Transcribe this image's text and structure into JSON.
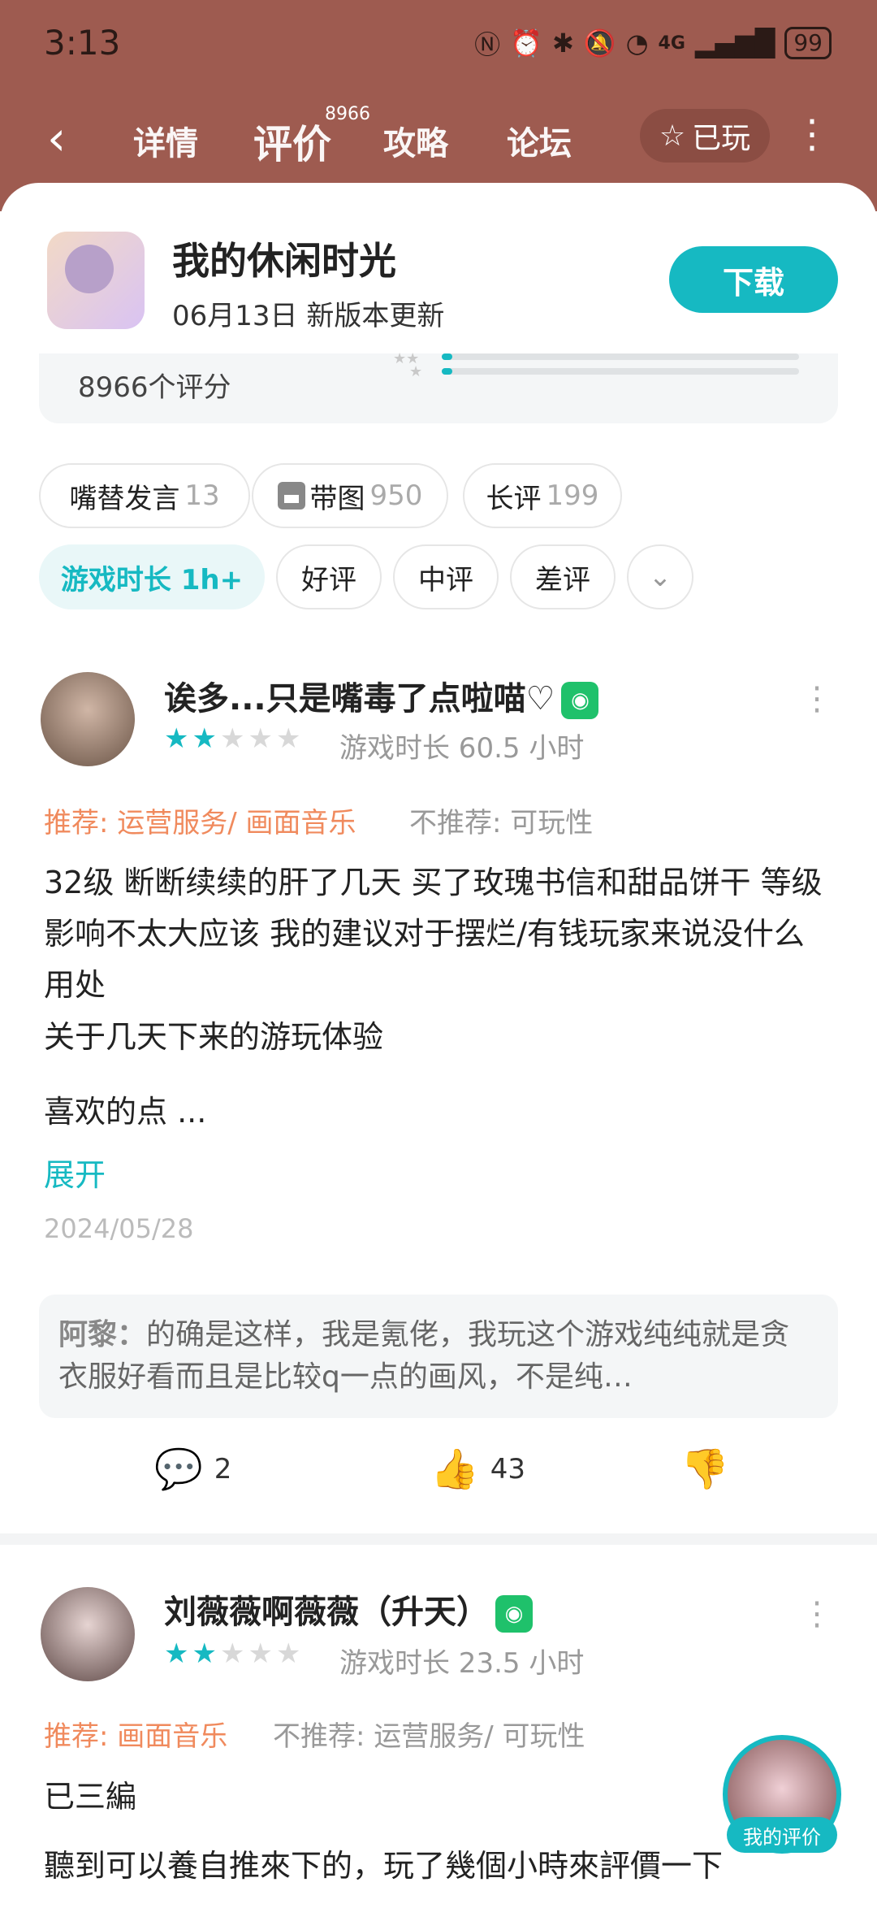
{
  "status_bar": {
    "time": "3:13",
    "battery": "99",
    "network": "4G"
  },
  "nav": {
    "back_icon": "chevron-left-icon",
    "tabs": [
      {
        "label": "详情"
      },
      {
        "label": "评价"
      },
      {
        "label": "攻略"
      },
      {
        "label": "论坛"
      }
    ],
    "review_badge": "8966",
    "played_label": "已玩"
  },
  "game": {
    "title": "我的休闲时光",
    "subtitle": "06月13日 新版本更新",
    "download_label": "下载"
  },
  "rating": {
    "count_label": "8966个评分",
    "bars": [
      0.03,
      0.03
    ]
  },
  "filters": {
    "row1": [
      {
        "label": "嘴替发言",
        "count": "13"
      },
      {
        "label": "带图",
        "count": "950"
      },
      {
        "label": "长评",
        "count": "199"
      }
    ],
    "row2": [
      {
        "label": "游戏时长 1h+"
      },
      {
        "label": "好评"
      },
      {
        "label": "中评"
      },
      {
        "label": "差评"
      }
    ]
  },
  "reviews": [
    {
      "username": "诶多...只是嘴毒了点啦喵♡",
      "stars": 2,
      "playtime": "游戏时长 60.5 小时",
      "recommend": "推荐: 运营服务/ 画面音乐",
      "not_recommend": "不推荐: 可玩性",
      "paragraphs": [
        "32级 断断续续的肝了几天 买了玫瑰书信和甜品饼干 等级影响不太大应该 我的建议对于摆烂/有钱玩家来说没什么用处",
        "关于几天下来的游玩体验",
        "喜欢的点 ..."
      ],
      "expand": "展开",
      "date": "2024/05/28",
      "reply_author": "阿黎：",
      "reply_text": "的确是这样，我是氪佬，我玩这个游戏纯纯就是贪衣服好看而且是比较q一点的画风，不是纯…",
      "comments": "2",
      "likes": "43"
    },
    {
      "username": "刘薇薇啊薇薇（升天）",
      "stars": 2,
      "playtime": "游戏时长 23.5 小时",
      "recommend": "推荐: 画面音乐",
      "not_recommend": "不推荐: 运营服务/ 可玩性",
      "paragraphs": [
        "已三編",
        "聽到可以養自推來下的，玩了幾個小時來評價一下"
      ]
    }
  ],
  "floating": {
    "label": "我的评价"
  },
  "colors": {
    "header_bg": "#9e5b50",
    "accent": "#16b9c2",
    "recommend": "#f08a5d"
  }
}
